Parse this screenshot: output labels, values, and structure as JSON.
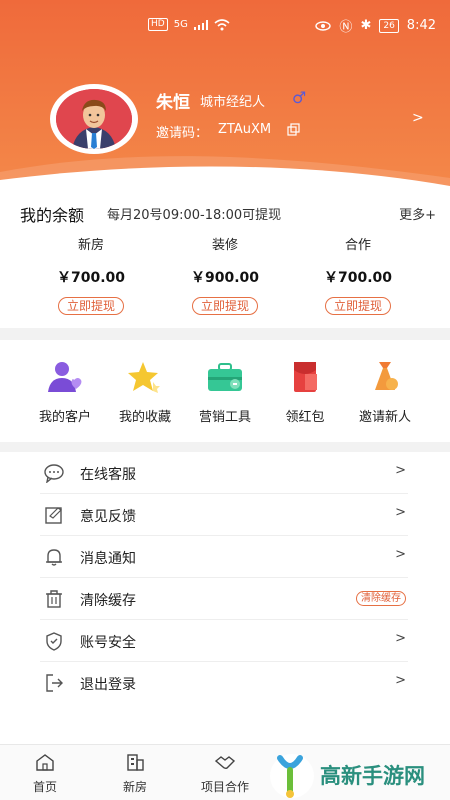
{
  "status_bar": {
    "left_badges": [
      "HD",
      "5G"
    ],
    "battery": "26",
    "time": "8:42"
  },
  "profile": {
    "name": "朱恒",
    "role": "城市经纪人",
    "invite_label": "邀请码：",
    "invite_code": "ZTAuXM"
  },
  "balance": {
    "title": "我的余额",
    "note": "每月20号09:00-18:00可提现",
    "more": "更多+",
    "columns": [
      {
        "label": "新房",
        "amount": "￥700.00",
        "button": "立即提现"
      },
      {
        "label": "装修",
        "amount": "￥900.00",
        "button": "立即提现"
      },
      {
        "label": "合作",
        "amount": "￥700.00",
        "button": "立即提现"
      }
    ]
  },
  "quick_actions": [
    {
      "label": "我的客户",
      "icon": "customers-icon"
    },
    {
      "label": "我的收藏",
      "icon": "star-icon"
    },
    {
      "label": "营销工具",
      "icon": "briefcase-icon"
    },
    {
      "label": "领红包",
      "icon": "red-envelope-icon"
    },
    {
      "label": "邀请新人",
      "icon": "invite-icon"
    }
  ],
  "settings": [
    {
      "label": "在线客服",
      "icon": "chat-icon"
    },
    {
      "label": "意见反馈",
      "icon": "feedback-icon"
    },
    {
      "label": "消息通知",
      "icon": "bell-icon"
    },
    {
      "label": "清除缓存",
      "icon": "trash-icon",
      "tag": "清除缓存"
    },
    {
      "label": "账号安全",
      "icon": "shield-icon"
    },
    {
      "label": "退出登录",
      "icon": "logout-icon"
    }
  ],
  "bottom_nav": [
    {
      "label": "首页",
      "icon": "home-icon"
    },
    {
      "label": "新房",
      "icon": "building-icon"
    },
    {
      "label": "项目合作",
      "icon": "handshake-icon"
    }
  ],
  "watermark": {
    "text": "高新手游网"
  },
  "colors": {
    "accent": "#ef6a3b",
    "accent_text": "#e0603a",
    "male": "#5a5ad6"
  }
}
